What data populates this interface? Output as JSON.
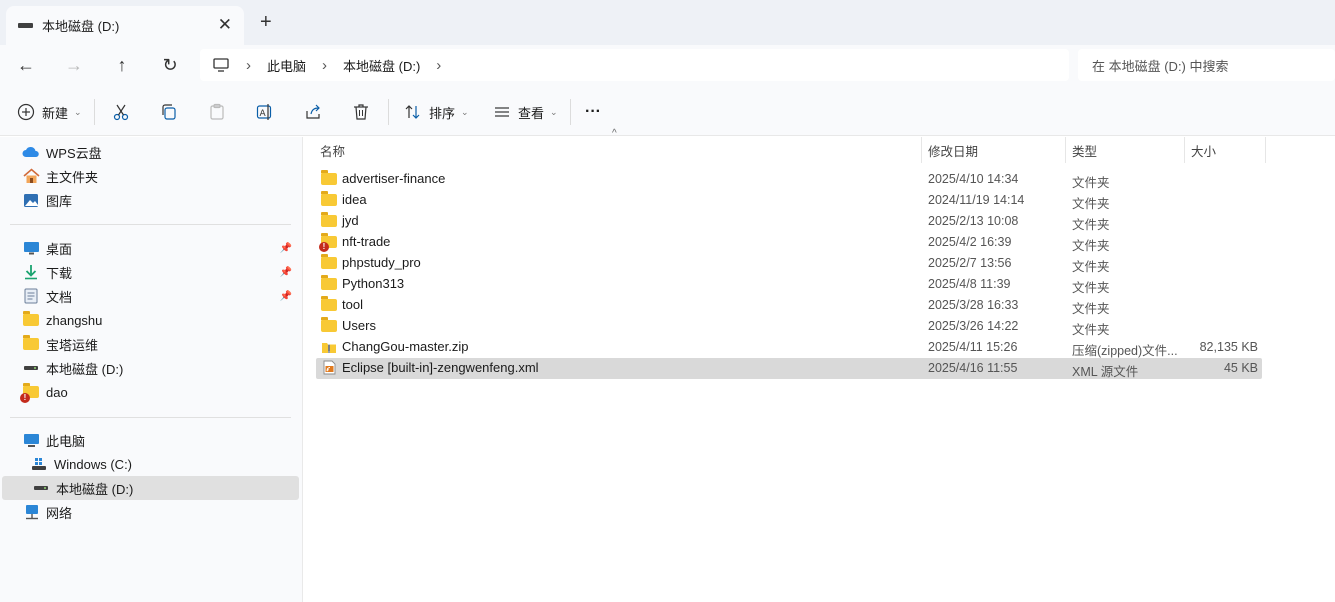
{
  "tab": {
    "title": "本地磁盘 (D:)",
    "close": "✕",
    "new": "+"
  },
  "nav": {
    "back": "←",
    "forward": "→",
    "up": "↑",
    "refresh": "↻"
  },
  "address": {
    "crumbs": [
      "此电脑",
      "本地磁盘 (D:)"
    ],
    "sep": "›"
  },
  "search": {
    "placeholder": "在 本地磁盘 (D:) 中搜索"
  },
  "commands": {
    "new_label": "新建",
    "sort_label": "排序",
    "view_label": "查看",
    "more": "···"
  },
  "sidebar": {
    "quick": [
      {
        "label": "WPS云盘",
        "icon": "cloud-icon"
      },
      {
        "label": "主文件夹",
        "icon": "home-icon"
      },
      {
        "label": "图库",
        "icon": "gallery-icon"
      }
    ],
    "pinned": [
      {
        "label": "桌面",
        "icon": "desktop-icon",
        "pinned": true
      },
      {
        "label": "下载",
        "icon": "download-icon",
        "pinned": true
      },
      {
        "label": "文档",
        "icon": "document-icon",
        "pinned": true
      },
      {
        "label": "zhangshu",
        "icon": "folder-icon"
      },
      {
        "label": "宝塔运维",
        "icon": "folder-icon"
      },
      {
        "label": "本地磁盘 (D:)",
        "icon": "drive-icon"
      },
      {
        "label": "dao",
        "icon": "folder-error-icon"
      }
    ],
    "devices": [
      {
        "label": "此电脑",
        "icon": "computer-icon"
      },
      {
        "label": "Windows (C:)",
        "icon": "windows-drive-icon"
      },
      {
        "label": "本地磁盘 (D:)",
        "icon": "drive-icon",
        "selected": true
      },
      {
        "label": "网络",
        "icon": "network-icon"
      }
    ]
  },
  "columns": {
    "name": "名称",
    "date": "修改日期",
    "type": "类型",
    "size": "大小"
  },
  "files": [
    {
      "name": "advertiser-finance",
      "date": "2025/4/10 14:34",
      "type": "文件夹",
      "size": "",
      "icon": "folder"
    },
    {
      "name": "idea",
      "date": "2024/11/19 14:14",
      "type": "文件夹",
      "size": "",
      "icon": "folder"
    },
    {
      "name": "jyd",
      "date": "2025/2/13 10:08",
      "type": "文件夹",
      "size": "",
      "icon": "folder"
    },
    {
      "name": "nft-trade",
      "date": "2025/4/2 16:39",
      "type": "文件夹",
      "size": "",
      "icon": "folder-error"
    },
    {
      "name": "phpstudy_pro",
      "date": "2025/2/7 13:56",
      "type": "文件夹",
      "size": "",
      "icon": "folder"
    },
    {
      "name": "Python313",
      "date": "2025/4/8 11:39",
      "type": "文件夹",
      "size": "",
      "icon": "folder"
    },
    {
      "name": "tool",
      "date": "2025/3/28 16:33",
      "type": "文件夹",
      "size": "",
      "icon": "folder"
    },
    {
      "name": "Users",
      "date": "2025/3/26 14:22",
      "type": "文件夹",
      "size": "",
      "icon": "folder"
    },
    {
      "name": "ChangGou-master.zip",
      "date": "2025/4/11 15:26",
      "type": "压缩(zipped)文件...",
      "size": "82,135 KB",
      "icon": "zip"
    },
    {
      "name": "Eclipse [built-in]-zengwenfeng.xml",
      "date": "2025/4/16 11:55",
      "type": "XML 源文件",
      "size": "45 KB",
      "icon": "xml",
      "selected": true
    }
  ],
  "colors": {
    "folder": "#f8c935",
    "accent": "#0067c0",
    "selected_row": "#d9d9d9"
  }
}
